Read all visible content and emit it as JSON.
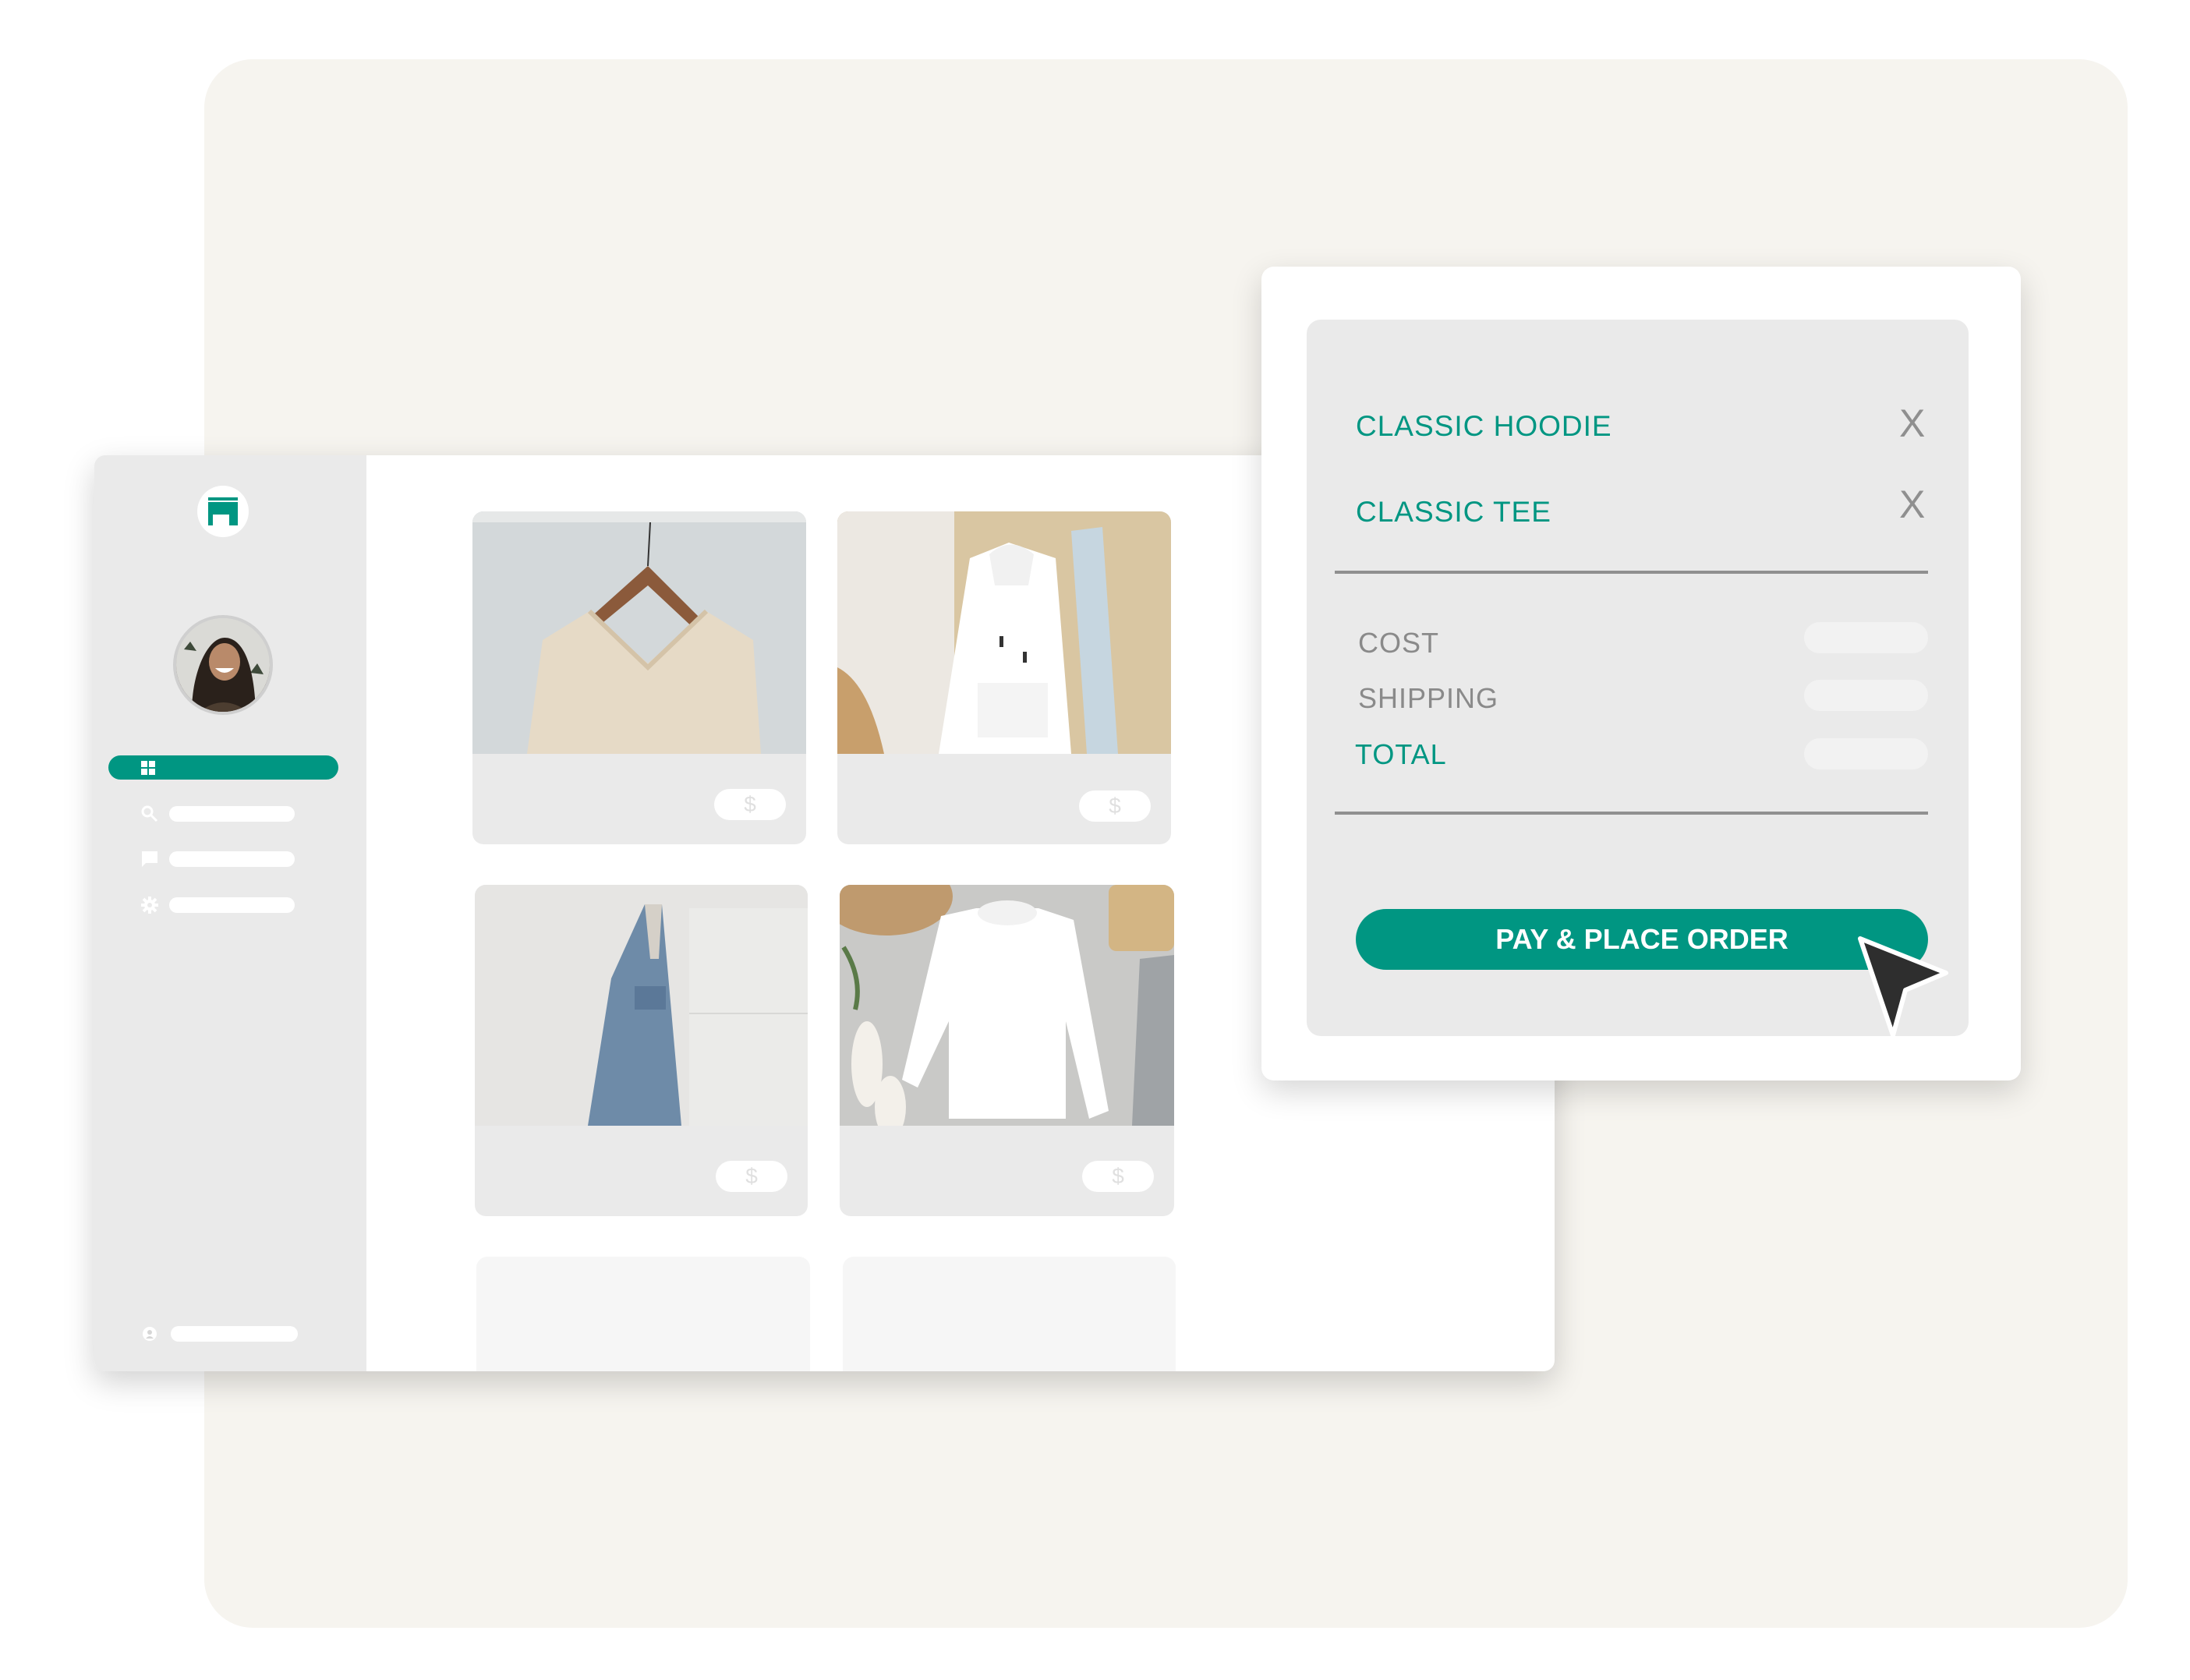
{
  "brand": {
    "accent": "#009682",
    "logo_icon": "storefront-icon"
  },
  "sidebar": {
    "avatar_alt": "user avatar",
    "nav_items": [
      {
        "icon": "grid-icon",
        "active": true
      },
      {
        "icon": "search-icon",
        "active": false
      },
      {
        "icon": "chat-icon",
        "active": false
      },
      {
        "icon": "gear-icon",
        "active": false
      }
    ],
    "profile": {
      "icon": "user-icon"
    }
  },
  "products": [
    {
      "name": "knit sweater",
      "price_symbol": "$"
    },
    {
      "name": "hoodie",
      "price_symbol": "$"
    },
    {
      "name": "denim jacket",
      "price_symbol": "$"
    },
    {
      "name": "sweatshirt",
      "price_symbol": "$"
    }
  ],
  "cart": {
    "items": [
      {
        "name": "CLASSIC HOODIE",
        "remove_label": "X"
      },
      {
        "name": "CLASSIC TEE",
        "remove_label": "X"
      }
    ],
    "summary": {
      "cost_label": "COST",
      "shipping_label": "SHIPPING",
      "total_label": "TOTAL"
    },
    "pay_button_label": "PAY & PLACE ORDER"
  }
}
